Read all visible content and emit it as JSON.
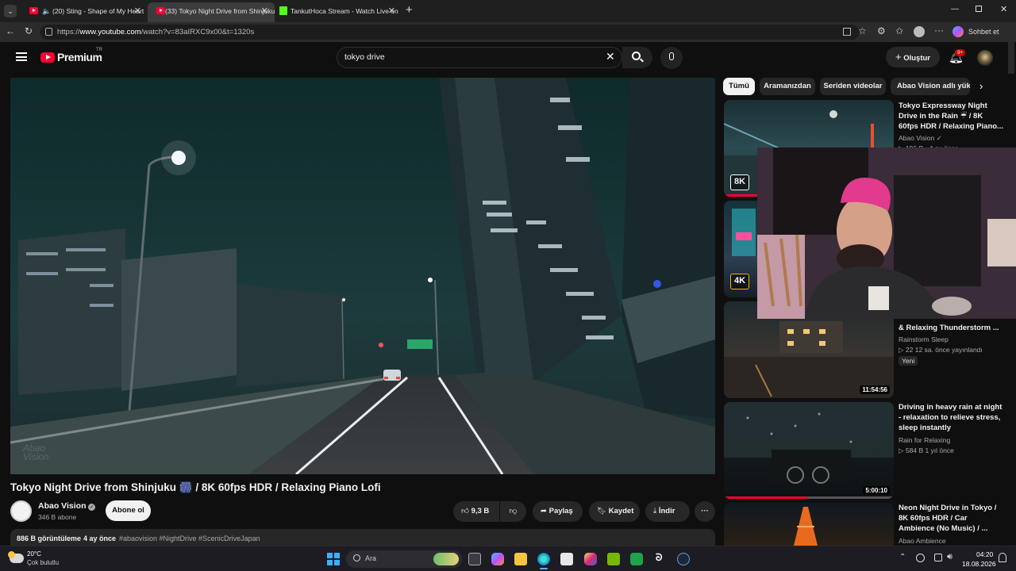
{
  "browser": {
    "tabs": [
      {
        "label": "(20) Sting - Shape of My Heart"
      },
      {
        "label": "(33) Tokyo Night Drive from Shinjuku"
      },
      {
        "label": "TankutHoca Stream - Watch Live on"
      }
    ],
    "url_prefix": "https://",
    "url_host": "www.youtube.com",
    "url_path": "/watch?v=83aIRXC9x00&t=1320s",
    "copilot_label": "Sohbet et"
  },
  "header": {
    "logo_text": "Premium",
    "logo_sup": "TR",
    "search_value": "tokyo drive",
    "create_label": "Oluştur",
    "notif_badge": "9+"
  },
  "video": {
    "watermark": "Abao Vision",
    "title": "Tokyo Night Drive from Shinjuku 🎆 / 8K 60fps HDR / Relaxing Piano Lofi",
    "channel": "Abao Vision",
    "subscribers": "346 B abone",
    "subscribe_label": "Abone ol",
    "likes": "9,3 B",
    "share_label": "Paylaş",
    "save_label": "Kaydet",
    "download_label": "İndir",
    "views": "886 B görüntüleme",
    "age": "4 ay önce",
    "hashtags": "#abaovision #NightDrive #ScenicDriveJapan"
  },
  "chips": [
    "Tümü",
    "Aramanızdan",
    "Seriden videolar",
    "Abao Vision adlı yükleyiciden"
  ],
  "recommendations": [
    {
      "title": "Tokyo Expressway Night Drive in the Rain ☔ / 8K 60fps HDR / Relaxing Piano...",
      "channel": "Abao Vision",
      "meta": "▷ 196 B · 4 ay önce",
      "badge": "8K",
      "duration": ""
    },
    {
      "title": "",
      "channel": "",
      "meta": "",
      "badge": "4K",
      "duration": ""
    },
    {
      "title": "& Relaxing Thunderstorm ...",
      "channel": "Rainstorm Sleep",
      "meta": "▷ 22  12 sa. önce yayınlandı",
      "tag": "Yeni",
      "duration": "11:54:56"
    },
    {
      "title": "Driving in heavy rain at night - relaxation to relieve stress, sleep instantly",
      "channel": "Rain for Relaxing",
      "meta": "▷ 584 B  1 yıl önce",
      "duration": "5:00:10"
    },
    {
      "title": "Neon Night Drive in Tokyo / 8K 60fps HDR / Car Ambience (No Music) / ...",
      "channel": "Abao Ambience",
      "meta": "",
      "duration": ""
    }
  ],
  "taskbar": {
    "weather_temp": "20°C",
    "weather_desc": "Çok bulutlu",
    "search_label": "Ara",
    "time": "04:20",
    "date": "18.08.2026"
  },
  "colors": {
    "accent_red": "#ff0033",
    "bg": "#0f0f0f",
    "chip_bg": "#272727"
  }
}
